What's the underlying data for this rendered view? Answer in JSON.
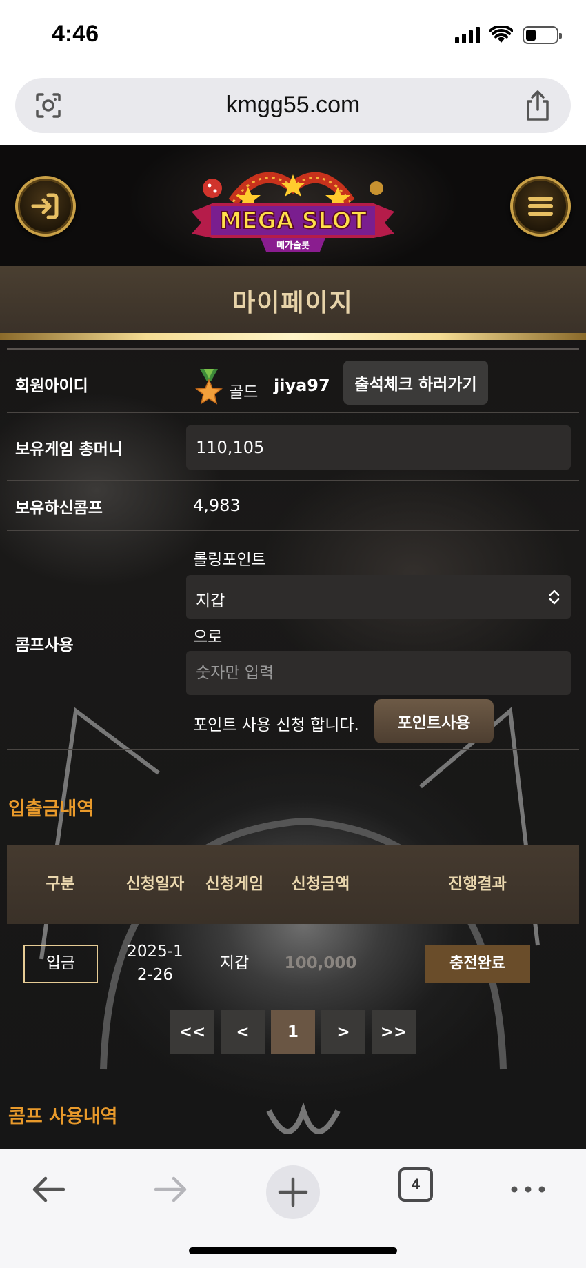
{
  "status_bar": {
    "time": "4:46"
  },
  "browser": {
    "url": "kmgg55.com",
    "tabs_count": "4"
  },
  "site": {
    "logo_text": "MEGA SLOT",
    "logo_subtext": "메가슬롯",
    "page_title": "마이페이지",
    "member": {
      "id_label": "회원아이디",
      "grade": "골드",
      "user_id": "jiya97",
      "attendance_button": "출석체크 하러가기",
      "money_label": "보유게임 총머니",
      "money_value": "110,105",
      "comp_label": "보유하신콤프",
      "comp_value": "4,983"
    },
    "comp_use": {
      "label": "콤프사용",
      "rolling_label": "롤링포인트",
      "select_value": "지갑",
      "to_label": "으로",
      "input_placeholder": "숫자만 입력",
      "apply_text": "포인트 사용 신청 합니다.",
      "apply_button": "포인트사용"
    },
    "history": {
      "title": "입출금내역",
      "headers": [
        "구분",
        "신청일자",
        "신청게임",
        "신청금액",
        "진행결과"
      ],
      "rows": [
        {
          "type": "입금",
          "date": "2025-12-26",
          "game": "지갑",
          "amount": "100,000",
          "result": "충전완료"
        }
      ]
    },
    "pagination": {
      "first": "<<",
      "prev": "<",
      "current": "1",
      "next": ">",
      "last": ">>"
    },
    "comp_history_title": "콤프 사용내역"
  },
  "colors": {
    "accent_gold": "#e6cc95",
    "section_orange": "#e99a2b",
    "title_bar": "#4a3f31"
  }
}
